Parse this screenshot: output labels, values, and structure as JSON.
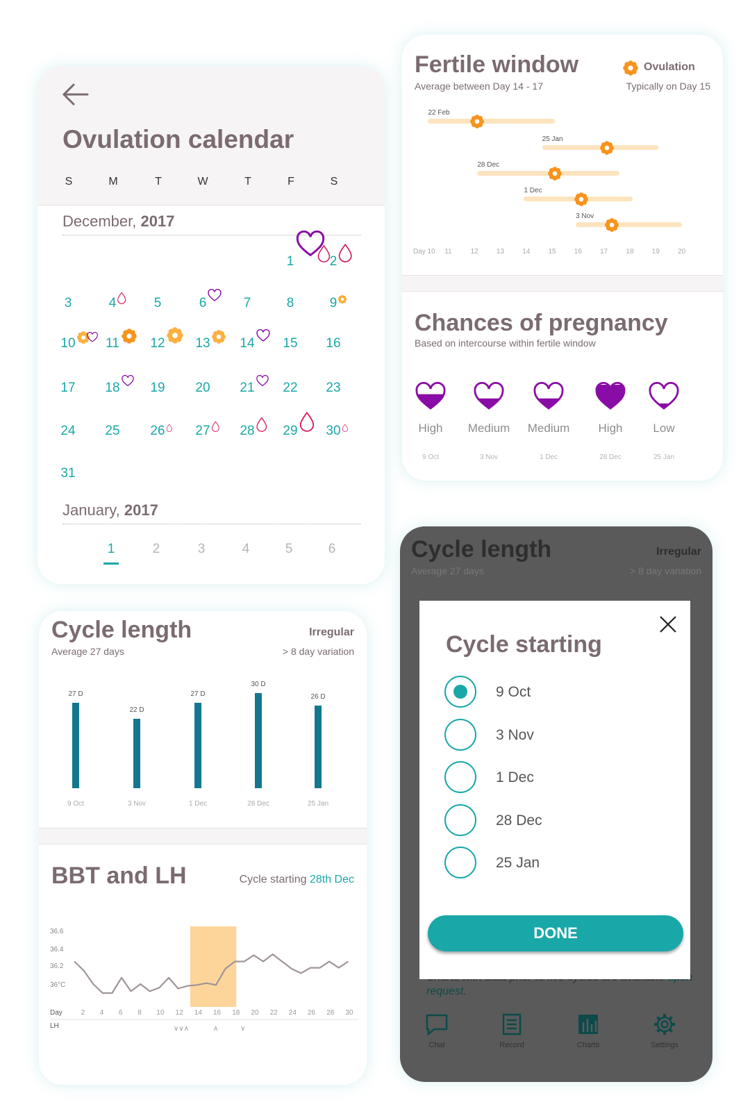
{
  "calendar": {
    "title": "Ovulation calendar",
    "weekdays": [
      "S",
      "M",
      "T",
      "W",
      "T",
      "F",
      "S"
    ],
    "month1": {
      "name": "December, ",
      "year": "2017"
    },
    "days": [
      "1",
      "2",
      "3",
      "4",
      "5",
      "6",
      "7",
      "8",
      "9",
      "10",
      "11",
      "12",
      "13",
      "14",
      "15",
      "16",
      "17",
      "18",
      "19",
      "20",
      "21",
      "22",
      "23",
      "24",
      "25",
      "26",
      "27",
      "28",
      "29",
      "30",
      "31"
    ],
    "month2": {
      "name": "January, ",
      "year": "2017"
    },
    "jan_days": [
      "1",
      "2",
      "3",
      "4",
      "5",
      "6"
    ]
  },
  "fertile": {
    "title": "Fertile window",
    "subtitle": "Average between Day 14 - 17",
    "ovulation_label": "Ovulation",
    "ovulation_sub": "Typically on Day 15",
    "rows": [
      {
        "label": "22 Feb",
        "start": 10.2,
        "end": 15.1,
        "ovulation": 12.1
      },
      {
        "label": "25 Jan",
        "start": 14.6,
        "end": 19.1,
        "ovulation": 17.1
      },
      {
        "label": "28 Dec",
        "start": 12.1,
        "end": 17.6,
        "ovulation": 15.1
      },
      {
        "label": "1 Dec",
        "start": 13.9,
        "end": 18.1,
        "ovulation": 16.1
      },
      {
        "label": "3 Nov",
        "start": 15.9,
        "end": 20.0,
        "ovulation": 17.3
      }
    ],
    "axis": [
      "Day 10",
      "11",
      "12",
      "13",
      "14",
      "15",
      "16",
      "17",
      "18",
      "19",
      "20"
    ]
  },
  "pregnancy": {
    "title": "Chances of pregnancy",
    "subtitle": "Based on intercourse within fertile window",
    "items": [
      {
        "level": "High",
        "date": "9 Oct",
        "fill": 0.62
      },
      {
        "level": "Medium",
        "date": "3 Nov",
        "fill": 0.45
      },
      {
        "level": "Medium",
        "date": "1 Dec",
        "fill": 0.45
      },
      {
        "level": "High",
        "date": "28 Dec",
        "fill": 1.0
      },
      {
        "level": "Low",
        "date": "25 Jan",
        "fill": 0.25
      }
    ]
  },
  "cycle": {
    "title": "Cycle length",
    "subtitle": "Average 27 days",
    "status": "Irregular",
    "variation": "> 8 day variation",
    "chart_data": {
      "type": "bar",
      "categories": [
        "9 Oct",
        "3 Nov",
        "1 Dec",
        "28 Dec",
        "25 Jan"
      ],
      "values": [
        27,
        22,
        27,
        30,
        26
      ],
      "data_labels": [
        "27 D",
        "22 D",
        "27 D",
        "30 D",
        "26 D"
      ],
      "color": "#13788f"
    }
  },
  "bbt": {
    "title": "BBT and LH",
    "cycle_prefix": "Cycle starting ",
    "cycle_date": "28th Dec",
    "chart_data": {
      "type": "line",
      "y_ticks": [
        "36.6",
        "36.4",
        "36.2",
        "36°C"
      ],
      "ylim": [
        35.9,
        36.7
      ],
      "x_tick_labels": [
        "Day",
        "2",
        "4",
        "6",
        "8",
        "10",
        "12",
        "14",
        "16",
        "18",
        "20",
        "22",
        "24",
        "26",
        "28",
        "30"
      ],
      "lh_label": "LH",
      "lh_marks": [
        "∨∨∧",
        "∧",
        "∨"
      ],
      "highlight_days": [
        14,
        18
      ],
      "x": [
        1,
        2,
        3,
        4,
        5,
        6,
        7,
        8,
        9,
        10,
        11,
        12,
        13,
        14,
        15,
        16,
        17,
        18,
        19,
        20,
        21,
        22,
        23,
        24,
        25,
        26,
        27,
        28,
        29,
        30
      ],
      "values": [
        36.35,
        36.25,
        36.1,
        36.0,
        36.0,
        36.17,
        36.02,
        36.1,
        36.02,
        36.06,
        36.17,
        36.05,
        36.08,
        36.09,
        36.11,
        36.09,
        36.27,
        36.35,
        36.35,
        36.42,
        36.35,
        36.43,
        36.35,
        36.27,
        36.22,
        36.28,
        36.28,
        36.35,
        36.28,
        36.35
      ],
      "color": "#a09497",
      "highlight_color": "#fdd59b"
    }
  },
  "dark": {
    "title": "Cycle length",
    "subtitle": "Average 27 days",
    "status": "Irregular",
    "variation": "> 8 day variation",
    "note_prefix": "Charts with data prior to five cycles are available ",
    "note_link": "upon request",
    "note_suffix": ".",
    "nav": [
      {
        "label": "Chat",
        "icon": "chat-icon"
      },
      {
        "label": "Record",
        "icon": "record-icon"
      },
      {
        "label": "Charts",
        "icon": "charts-icon"
      },
      {
        "label": "Settings",
        "icon": "settings-icon"
      }
    ]
  },
  "modal": {
    "title": "Cycle starting",
    "options": [
      "9 Oct",
      "3 Nov",
      "1 Dec",
      "28 Dec",
      "25 Jan"
    ],
    "selected": "9 Oct",
    "done_label": "DONE"
  },
  "colors": {
    "teal": "#1aa7a8",
    "pink": "#d81b60",
    "orange": "#f7941d",
    "purple": "#8a0ca6",
    "bar": "#13788f"
  }
}
